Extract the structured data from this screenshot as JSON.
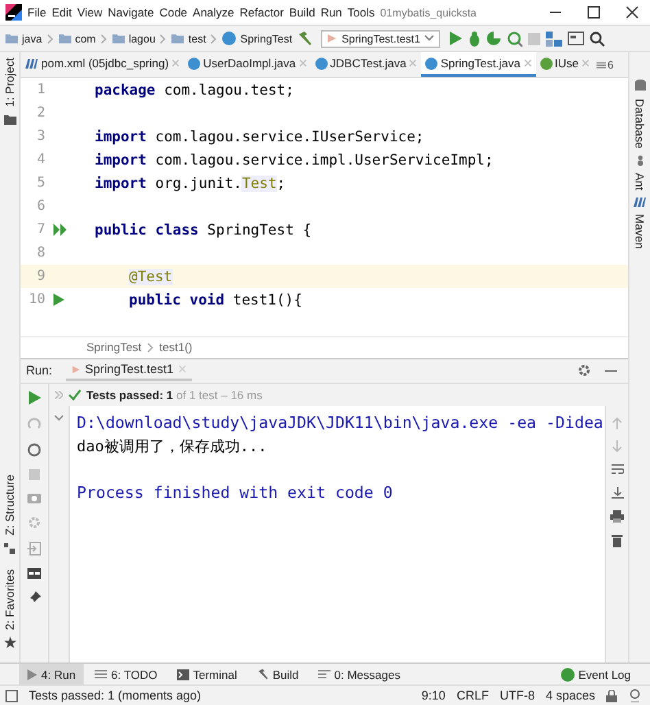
{
  "menu": [
    "File",
    "Edit",
    "View",
    "Navigate",
    "Code",
    "Analyze",
    "Refactor",
    "Build",
    "Run",
    "Tools"
  ],
  "window": {
    "title": "01mybatis_quicksta"
  },
  "breadcrumbs": [
    {
      "label": "java",
      "kind": "folder"
    },
    {
      "label": "com",
      "kind": "folder"
    },
    {
      "label": "lagou",
      "kind": "folder"
    },
    {
      "label": "test",
      "kind": "folder"
    },
    {
      "label": "SpringTest",
      "kind": "class"
    }
  ],
  "run_config": "SpringTest.test1",
  "tabs": [
    {
      "label": "pom.xml (05jdbc_spring)",
      "kind": "maven",
      "selected": false
    },
    {
      "label": "UserDaoImpl.java",
      "kind": "class",
      "selected": false
    },
    {
      "label": "JDBCTest.java",
      "kind": "class",
      "selected": false
    },
    {
      "label": "SpringTest.java",
      "kind": "class",
      "selected": true
    },
    {
      "label": "IUse",
      "kind": "interface",
      "selected": false
    }
  ],
  "tab_overflow": "6",
  "left_tools": [
    "1: Project",
    "Z: Structure",
    "2: Favorites"
  ],
  "right_tools": [
    "Database",
    "Ant",
    "Maven"
  ],
  "code": [
    {
      "number": "1",
      "kind": "code",
      "current": false,
      "indented": false,
      "tokens": [
        {
          "text": "package",
          "kind": "keyword"
        },
        {
          "text": " com.lagou.test;",
          "kind": "plain"
        }
      ]
    },
    {
      "number": "2",
      "kind": "code",
      "current": false
    },
    {
      "number": "3",
      "kind": "code",
      "current": false,
      "indented": false,
      "tokens": [
        {
          "text": "import",
          "kind": "keyword"
        },
        {
          "text": " com.lagou.service.IUserService;",
          "kind": "plain"
        }
      ]
    },
    {
      "number": "4",
      "kind": "code",
      "current": false,
      "indented": false,
      "tokens": [
        {
          "text": "import",
          "kind": "keyword"
        },
        {
          "text": " com.lagou.service.impl.UserServiceImpl;",
          "kind": "plain"
        }
      ]
    },
    {
      "number": "5",
      "kind": "code",
      "current": false,
      "indented": false,
      "tokens": [
        {
          "text": "import",
          "kind": "keyword"
        },
        {
          "text": " org.junit.",
          "kind": "plain"
        },
        {
          "text": "Test",
          "kind": "highlight"
        },
        {
          "text": ";",
          "kind": "plain"
        }
      ]
    },
    {
      "number": "6",
      "kind": "code",
      "current": false
    },
    {
      "number": "7",
      "kind": "run-all",
      "current": false,
      "indented": false,
      "tokens": [
        {
          "text": "public class",
          "kind": "keyword"
        },
        {
          "text": " SpringTest {",
          "kind": "plain"
        }
      ]
    },
    {
      "number": "8",
      "kind": "code",
      "current": false
    },
    {
      "number": "9",
      "kind": "code",
      "current": true,
      "indented": true,
      "tokens": [
        {
          "text": "@Test",
          "kind": "annotation"
        }
      ]
    },
    {
      "number": "10",
      "kind": "run",
      "current": false,
      "indented": true,
      "tokens": [
        {
          "text": "public void",
          "kind": "keyword"
        },
        {
          "text": " test1(){",
          "kind": "plain"
        }
      ]
    }
  ],
  "editor_breadcrumbs": [
    "SpringTest",
    "test1()"
  ],
  "run_panel": {
    "label": "Run:",
    "tab": "SpringTest.test1",
    "status": "**Tests passed: 1** of 1 test – 16 ms",
    "console": [
      {
        "text": "D:\\download\\study\\javaJDK\\JDK11\\bin\\java.exe -ea -Didea",
        "kind": "command"
      },
      {
        "text": "dao被调用了，保存成功...",
        "kind": "output"
      },
      {
        "kind": "blank"
      },
      {
        "text": "Process finished with exit code 0",
        "kind": "command"
      }
    ]
  },
  "tool_tabs": [
    {
      "label": "4: Run",
      "kind": "run",
      "selected": true
    },
    {
      "label": "6: TODO",
      "kind": "todo",
      "selected": false
    },
    {
      "label": "Terminal",
      "kind": "terminal",
      "selected": false
    },
    {
      "label": "Build",
      "kind": "build",
      "selected": false
    },
    {
      "label": "0: Messages",
      "kind": "messages",
      "selected": false
    }
  ],
  "event_log": "Event Log",
  "status_bar": {
    "message": "Tests passed: 1 (moments ago)",
    "items": [
      "9:10",
      "CRLF",
      "UTF-8",
      "4 spaces"
    ]
  }
}
